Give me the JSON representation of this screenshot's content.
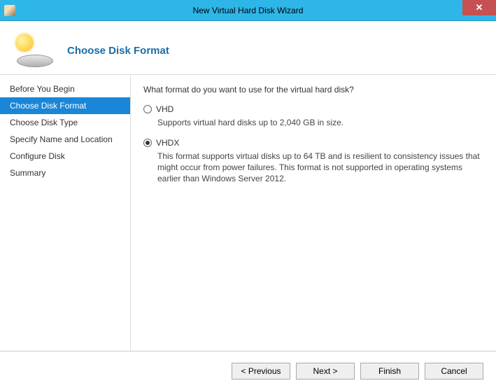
{
  "window": {
    "title": "New Virtual Hard Disk Wizard"
  },
  "header": {
    "pageTitle": "Choose Disk Format"
  },
  "sidebar": {
    "steps": [
      {
        "label": "Before You Begin",
        "selected": false
      },
      {
        "label": "Choose Disk Format",
        "selected": true
      },
      {
        "label": "Choose Disk Type",
        "selected": false
      },
      {
        "label": "Specify Name and Location",
        "selected": false
      },
      {
        "label": "Configure Disk",
        "selected": false
      },
      {
        "label": "Summary",
        "selected": false
      }
    ]
  },
  "content": {
    "question": "What format do you want to use for the virtual hard disk?",
    "options": [
      {
        "label": "VHD",
        "description": "Supports virtual hard disks up to 2,040 GB in size.",
        "checked": false
      },
      {
        "label": "VHDX",
        "description": "This format supports virtual disks up to 64 TB and is resilient to consistency issues that might occur from power failures. This format is not supported in operating systems earlier than Windows Server 2012.",
        "checked": true
      }
    ]
  },
  "footer": {
    "previous": "< Previous",
    "next": "Next >",
    "finish": "Finish",
    "cancel": "Cancel"
  }
}
